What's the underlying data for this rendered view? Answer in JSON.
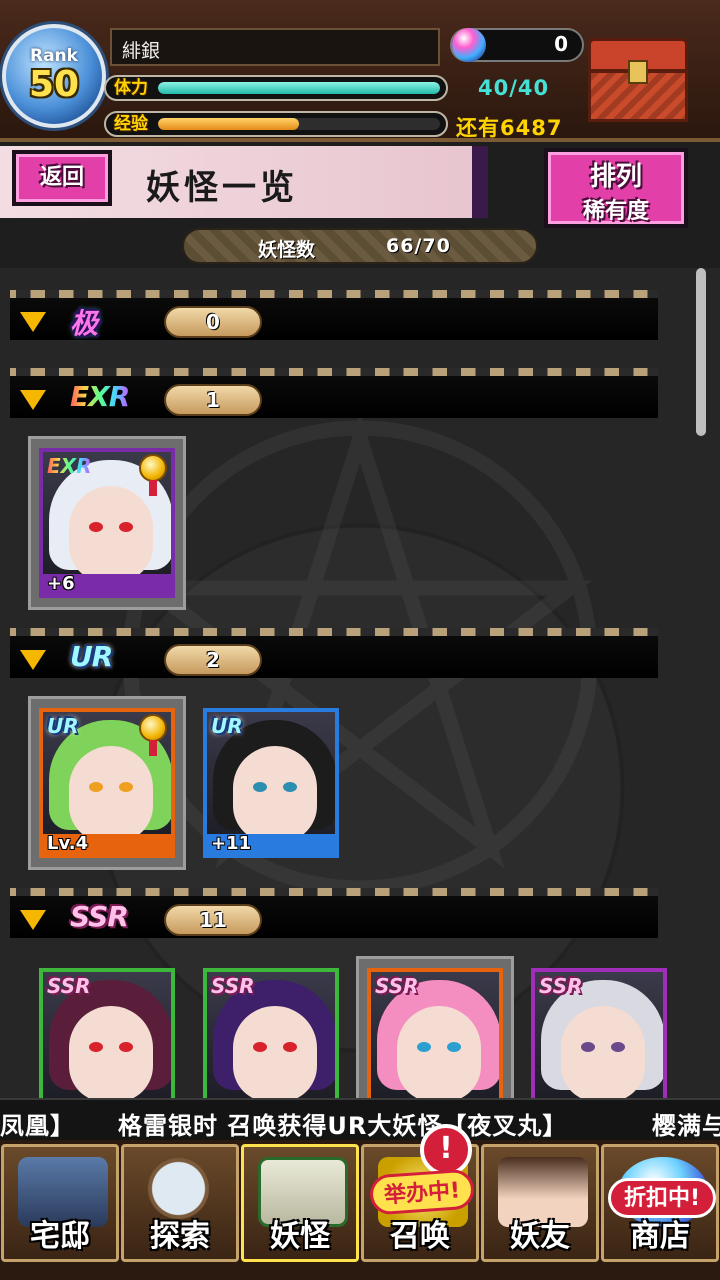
{
  "player": {
    "rank_label": "Rank",
    "rank": "50",
    "name": "緋銀",
    "stamina_label": "体力",
    "stamina_text": "40/40",
    "stamina_ratio": 1.0,
    "exp_label": "经验",
    "exp_ratio": 0.5,
    "exp_remaining_text": "还有6487",
    "gems": "0"
  },
  "header": {
    "back_label": "返回",
    "title": "妖怪一览",
    "sort_title": "排列",
    "sort_value": "稀有度"
  },
  "count": {
    "label": "妖怪数",
    "value": "66/70"
  },
  "categories": [
    {
      "rarity": "极",
      "count": "0"
    },
    {
      "rarity": "EXR",
      "count": "1"
    },
    {
      "rarity": "UR",
      "count": "2"
    },
    {
      "rarity": "SSR",
      "count": "11"
    }
  ],
  "cards": [
    {
      "rarity": "EXR",
      "bottom_text": "+6",
      "hair_color": "#e8ecf4",
      "frame_color": "#7a2ba8",
      "eye_color": "#d8222c",
      "medal": true
    },
    {
      "rarity": "UR",
      "bottom_text": "Lv.4",
      "hair_color": "#7fd35a",
      "frame_color": "#e7630d",
      "eye_color": "#f0a020",
      "medal": true
    },
    {
      "rarity": "UR",
      "bottom_text": "+11",
      "hair_color": "#1c1c1c",
      "frame_color": "#2a7be0",
      "eye_color": "#2c8fb0",
      "medal": false
    },
    {
      "rarity": "SSR",
      "bottom_text": "",
      "hair_color": "#5a1e3a",
      "frame_color": "#3db83d",
      "eye_color": "#d8222c",
      "medal": false
    },
    {
      "rarity": "SSR",
      "bottom_text": "",
      "hair_color": "#3e1f6a",
      "frame_color": "#3db83d",
      "eye_color": "#d8222c",
      "medal": false
    },
    {
      "rarity": "SSR",
      "bottom_text": "",
      "hair_color": "#f58ec0",
      "frame_color": "#e7630d",
      "eye_color": "#2c9fd0",
      "medal": false
    },
    {
      "rarity": "SSR",
      "bottom_text": "",
      "hair_color": "#d9d9e2",
      "frame_color": "#a12dbb",
      "eye_color": "#6a4a8a",
      "medal": false
    }
  ],
  "ticker": {
    "left_fragment": "凤凰】",
    "message": "格雷银时 召唤获得UR大妖怪【夜叉丸】",
    "right_fragment": "樱满与"
  },
  "nav": [
    {
      "label": "宅邸",
      "icon": "mansion-icon"
    },
    {
      "label": "探索",
      "icon": "magnifier-icon"
    },
    {
      "label": "妖怪",
      "icon": "scroll-icon"
    },
    {
      "label": "召唤",
      "icon": "summon-icon"
    },
    {
      "label": "妖友",
      "icon": "friend-icon"
    },
    {
      "label": "商店",
      "icon": "shop-orb-icon"
    }
  ],
  "nav_badges": {
    "event": "举办中!",
    "sale": "折扣中!",
    "alert": "!"
  }
}
